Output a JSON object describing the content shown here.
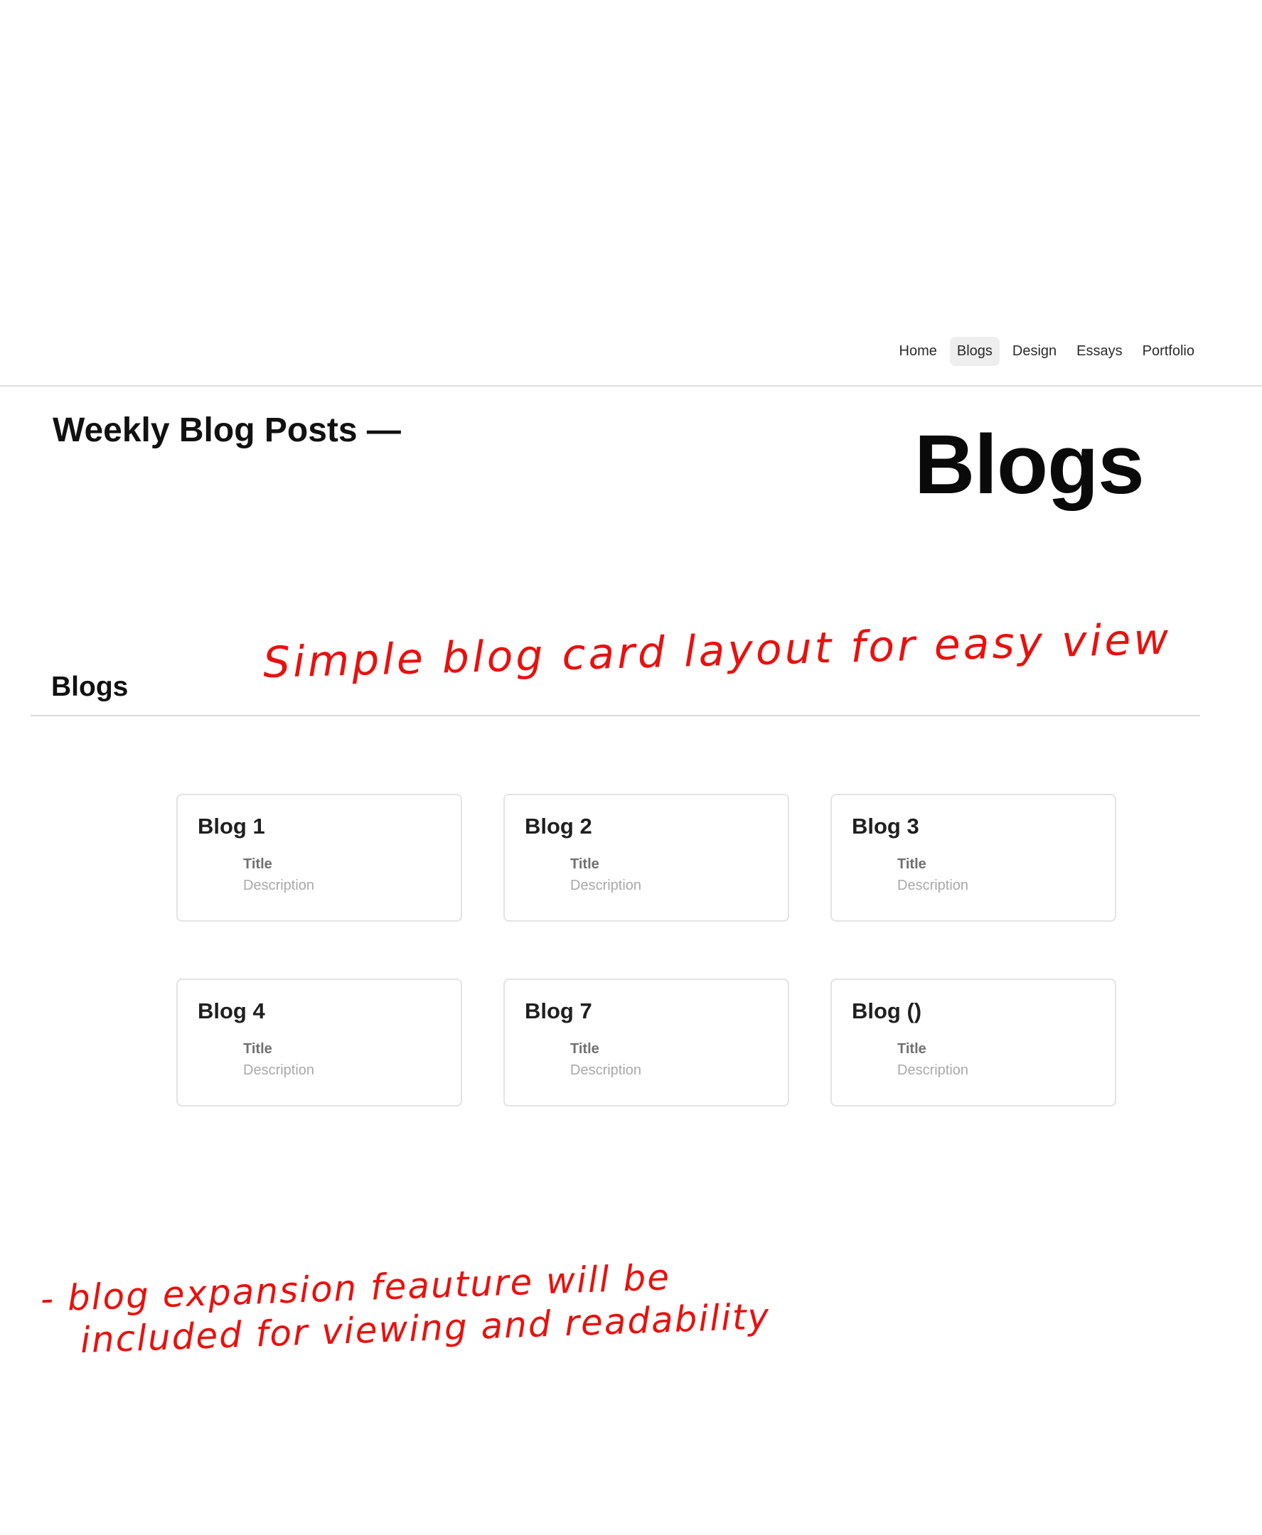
{
  "nav": {
    "items": [
      {
        "label": "Home",
        "active": false
      },
      {
        "label": "Blogs",
        "active": true
      },
      {
        "label": "Design",
        "active": false
      },
      {
        "label": "Essays",
        "active": false
      },
      {
        "label": "Portfolio",
        "active": false
      }
    ]
  },
  "hero": {
    "subtitle": "Weekly Blog Posts —",
    "title": "Blogs"
  },
  "section": {
    "heading": "Blogs"
  },
  "annotations": {
    "top": "Simple blog card layout for easy view",
    "bottom_line1": "- blog expansion feauture will be",
    "bottom_line2": "included for viewing and readability"
  },
  "cards": [
    {
      "name": "Blog 1",
      "title": "Title",
      "description": "Description"
    },
    {
      "name": "Blog 2",
      "title": "Title",
      "description": "Description"
    },
    {
      "name": "Blog 3",
      "title": "Title",
      "description": "Description"
    },
    {
      "name": "Blog 4",
      "title": "Title",
      "description": "Description"
    },
    {
      "name": "Blog 7",
      "title": "Title",
      "description": "Description"
    },
    {
      "name": "Blog ()",
      "title": "Title",
      "description": "Description"
    }
  ],
  "colors": {
    "annotation": "#e8110e",
    "active_nav_bg": "#eeeeee",
    "divider": "#dedede",
    "card_border": "#e3e3e3"
  }
}
